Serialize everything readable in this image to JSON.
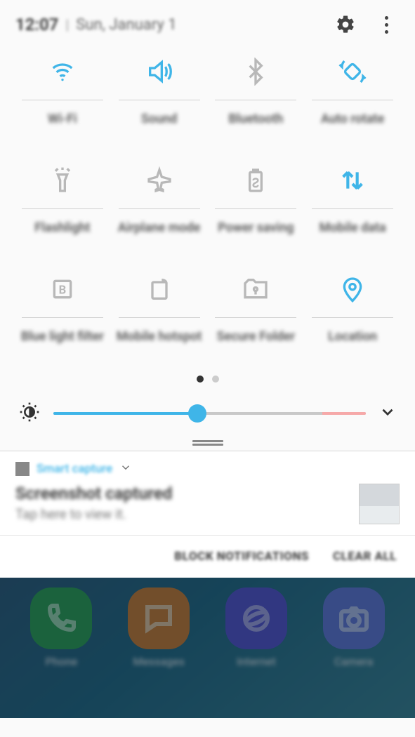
{
  "status": {
    "time": "12:07",
    "date": "Sun, January 1"
  },
  "quick_settings": {
    "tiles": [
      {
        "name": "wifi",
        "label": "Wi-Fi",
        "active": true
      },
      {
        "name": "sound",
        "label": "Sound",
        "active": true
      },
      {
        "name": "bluetooth",
        "label": "Bluetooth",
        "active": false
      },
      {
        "name": "autorotate",
        "label": "Auto\nrotate",
        "active": true
      },
      {
        "name": "flashlight",
        "label": "Flashlight",
        "active": false
      },
      {
        "name": "airplane",
        "label": "Airplane\nmode",
        "active": false
      },
      {
        "name": "powersaving",
        "label": "Power\nsaving",
        "active": false
      },
      {
        "name": "mobiledata",
        "label": "Mobile\ndata",
        "active": true
      },
      {
        "name": "bluelight",
        "label": "Blue light\nfilter",
        "active": false
      },
      {
        "name": "hotspot",
        "label": "Mobile\nhotspot",
        "active": false
      },
      {
        "name": "securefolder",
        "label": "Secure\nFolder",
        "active": false
      },
      {
        "name": "location",
        "label": "Location",
        "active": true
      }
    ],
    "page_index": 0,
    "page_count": 2
  },
  "brightness": {
    "percent": 46
  },
  "notification": {
    "app": "Smart capture",
    "title": "Screenshot captured",
    "subtitle": "Tap here to view it."
  },
  "actions": {
    "block": "BLOCK NOTIFICATIONS",
    "clear": "CLEAR ALL"
  },
  "dock": [
    {
      "name": "phone",
      "label": "Phone"
    },
    {
      "name": "messages",
      "label": "Messages"
    },
    {
      "name": "internet",
      "label": "Internet"
    },
    {
      "name": "camera",
      "label": "Camera"
    }
  ]
}
